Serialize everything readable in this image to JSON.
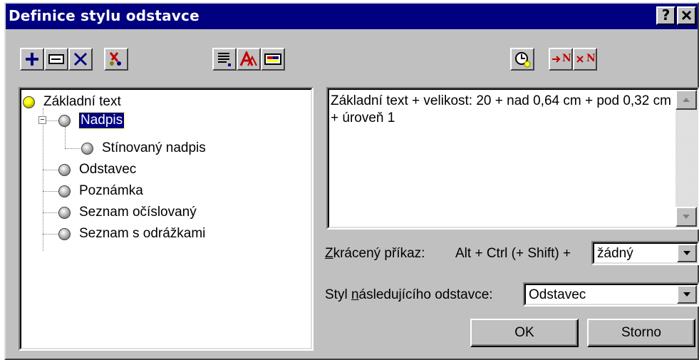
{
  "window": {
    "title": "Definice stylu odstavce",
    "help_label": "?",
    "close_label": "✕"
  },
  "toolbar_left": [
    {
      "name": "add-style-button",
      "icon": "plus-icon"
    },
    {
      "name": "rename-style-button",
      "icon": "rename-icon"
    },
    {
      "name": "delete-style-button",
      "icon": "delete-icon"
    },
    {
      "name": "cut-style-button",
      "icon": "scissors-icon"
    },
    {
      "name": "paragraph-format-button",
      "icon": "paragraph-icon"
    },
    {
      "name": "font-format-button",
      "icon": "font-icon"
    },
    {
      "name": "style-properties-button",
      "icon": "properties-icon"
    }
  ],
  "toolbar_right": [
    {
      "name": "shortcut-key-button",
      "icon": "clock-icon"
    },
    {
      "name": "insert-numbering-button",
      "icon": "add-numbering-icon",
      "label": "N"
    },
    {
      "name": "remove-numbering-button",
      "icon": "remove-numbering-icon",
      "label": "N"
    }
  ],
  "tree": {
    "items": [
      {
        "label": "Základní text",
        "level": 0,
        "ball": "yellow",
        "selected": false
      },
      {
        "label": "Nadpis",
        "level": 1,
        "ball": "gray",
        "selected": true,
        "expander": "−"
      },
      {
        "label": "Stínovaný nadpis",
        "level": 2,
        "ball": "gray",
        "selected": false
      },
      {
        "label": "Odstavec",
        "level": 1,
        "ball": "gray",
        "selected": false
      },
      {
        "label": "Poznámka",
        "level": 1,
        "ball": "gray",
        "selected": false
      },
      {
        "label": "Seznam očíslovaný",
        "level": 1,
        "ball": "gray",
        "selected": false
      },
      {
        "label": "Seznam s odrážkami",
        "level": 1,
        "ball": "gray",
        "selected": false
      }
    ]
  },
  "description": {
    "text": "Základní text + velikost: 20 + nad 0,64 cm  + pod 0,32 cm  + úroveň 1"
  },
  "shortcut": {
    "label_accel": "Z",
    "label_rest": "krácený příkaz:",
    "keys_text": "Alt + Ctrl (+ Shift) +",
    "value": "žádný"
  },
  "next_style": {
    "label_before": "Styl ",
    "label_accel": "n",
    "label_rest": "ásledujícího odstavce:",
    "value": "Odstavec"
  },
  "buttons": {
    "ok": "OK",
    "cancel": "Storno"
  },
  "colors": {
    "titlebar": "#000080",
    "face": "#c0c0c0",
    "selection": "#000080"
  }
}
